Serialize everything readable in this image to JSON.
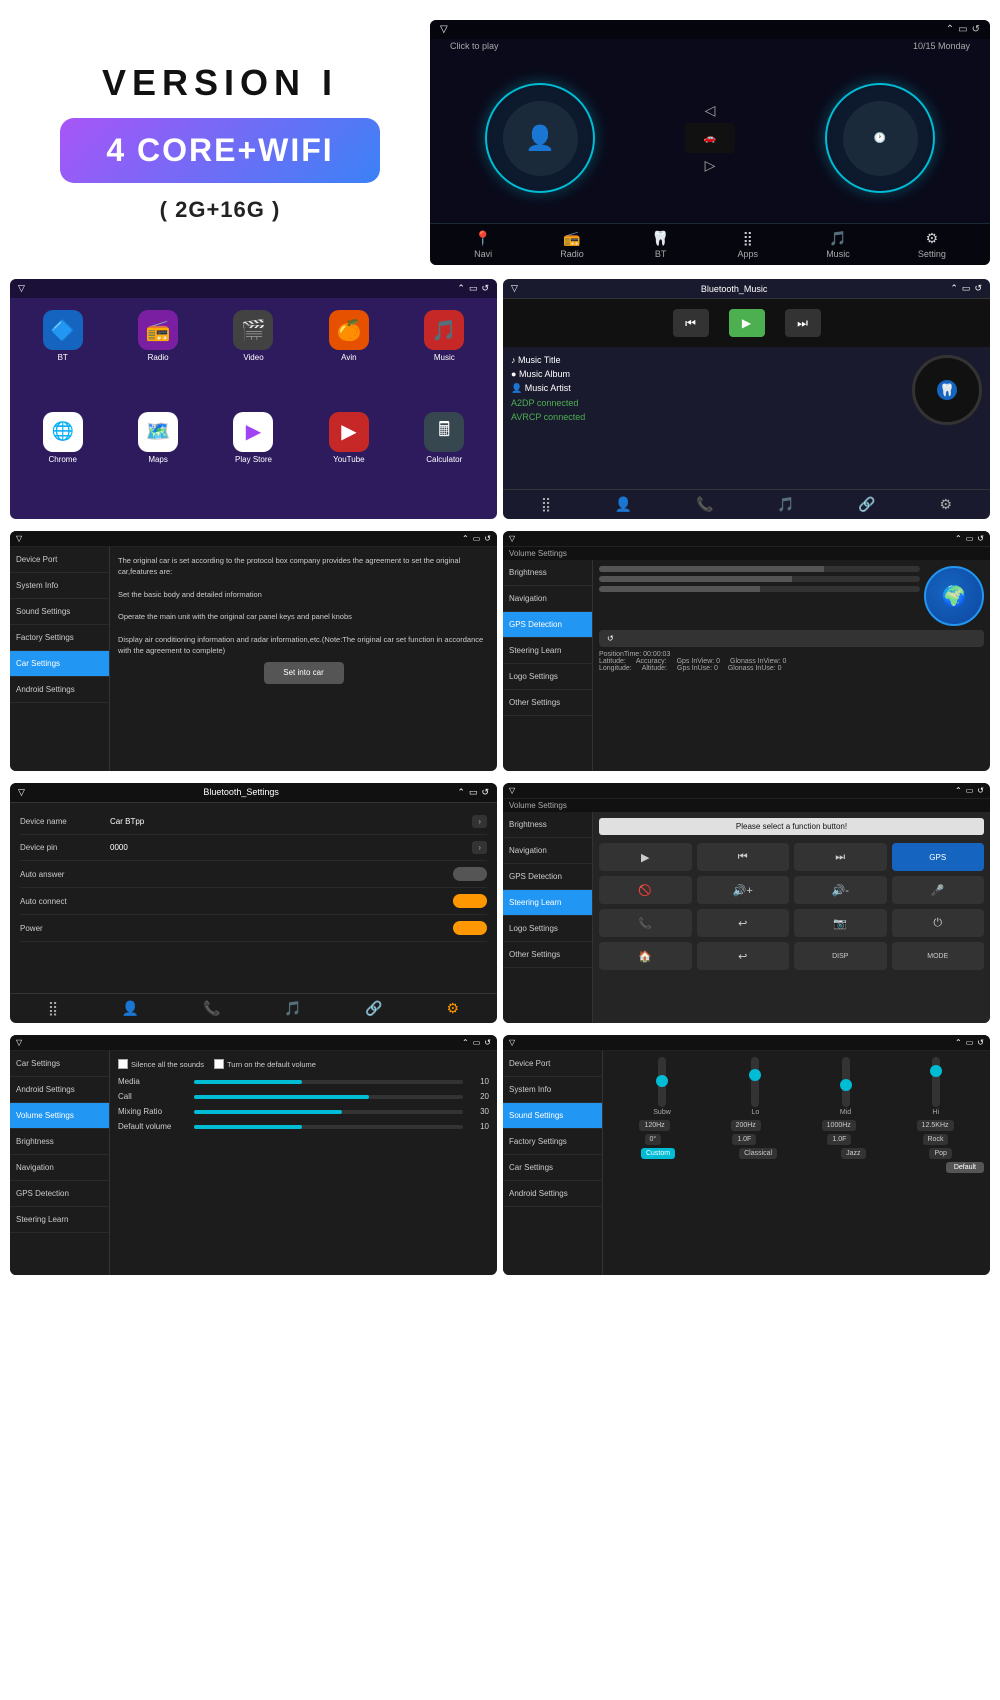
{
  "header": {
    "version_label": "VERSION  I",
    "core_wifi_label": "4 CORE+WIFI",
    "storage_label": "( 2G+16G )"
  },
  "car_screen": {
    "click_to_play": "Click to play",
    "date": "10/15 Monday",
    "nav_items": [
      "Navi",
      "Radio",
      "BT",
      "Apps",
      "Music",
      "Setting"
    ]
  },
  "app_launcher": {
    "apps": [
      {
        "label": "BT",
        "icon": "🔵"
      },
      {
        "label": "Radio",
        "icon": "📻"
      },
      {
        "label": "Video",
        "icon": "🎬"
      },
      {
        "label": "Avin",
        "icon": "🍊"
      },
      {
        "label": "Music",
        "icon": "🎵"
      },
      {
        "label": "Chrome",
        "icon": "🌐"
      },
      {
        "label": "Maps",
        "icon": "🗺️"
      },
      {
        "label": "Play Store",
        "icon": "▶"
      },
      {
        "label": "YouTube",
        "icon": "▶"
      },
      {
        "label": "Calculator",
        "icon": "🖩"
      }
    ]
  },
  "bt_music": {
    "title": "Bluetooth_Music",
    "music_title": "Music Title",
    "music_album": "Music Album",
    "music_artist": "Music Artist",
    "a2dp": "A2DP connected",
    "avrcp": "AVRCP connected"
  },
  "settings_panel": {
    "items": [
      "Device Port",
      "System Info",
      "Sound Settings",
      "Factory Settings",
      "Car Settings",
      "Android Settings"
    ],
    "active_index": 4,
    "content": "The original car is set according to the protocol box company provides the agreement to set the original car,features are:\n\nSet the basic body and detailed information\n\nOperate the main unit with the original car panel keys and panel knobs\n\nDisplay air conditioning information and radar information,etc.(Note:The original car set function in accordance with the agreement to complete)",
    "set_into_car": "Set into car"
  },
  "gps_screen": {
    "title": "Volume Settings",
    "sidebar_items": [
      "Brightness",
      "Navigation",
      "GPS Detection",
      "Steering Learn",
      "Logo Settings",
      "Other Settings"
    ],
    "active": "GPS Detection",
    "position_time": "PositionTime: 00:00:03",
    "latitude": "Latitude:",
    "longitude": "Longitude:",
    "accuracy": "Accuracy:",
    "altitude": "Altitude:",
    "gps_inview": "Gps InView: 0",
    "glonass_inview": "Glonass InView: 0",
    "gps_inuse": "Gps InUse: 0",
    "glonass_inuse": "Glonass InUse: 0"
  },
  "bt_settings": {
    "title": "Bluetooth_Settings",
    "device_name_label": "Device name",
    "device_name_value": "Car BTpp",
    "device_pin_label": "Device pin",
    "device_pin_value": "0000",
    "auto_answer_label": "Auto answer",
    "auto_connect_label": "Auto connect",
    "power_label": "Power"
  },
  "steering_screen": {
    "title": "Volume Settings",
    "sidebar_items": [
      "Brightness",
      "Navigation",
      "GPS Detection",
      "Steering Learn",
      "Logo Settings",
      "Other Settings"
    ],
    "active": "Steering Learn",
    "prompt": "Please select a function button!",
    "buttons": [
      "▶",
      "⏮",
      "⏭",
      "GPS",
      "🚫",
      "🔊+",
      "🔊-",
      "🎤",
      "📞",
      "↩",
      "📷",
      "⏻",
      "🏠",
      "↩",
      "DISP",
      "MODE"
    ]
  },
  "volume_settings": {
    "title": "Volume Settings",
    "sidebar_items": [
      "Car Settings",
      "Android Settings",
      "Volume Settings",
      "Brightness",
      "Navigation",
      "GPS Detection",
      "Steering Learn"
    ],
    "active": "Volume Settings",
    "silence_all": "Silence all the sounds",
    "turn_on_default": "Turn on the default volume",
    "media_label": "Media",
    "media_value": "10",
    "call_label": "Call",
    "call_value": "20",
    "mixing_label": "Mixing Ratio",
    "mixing_value": "30",
    "default_label": "Default volume",
    "default_value": "10"
  },
  "eq_settings": {
    "title": "Sound Settings",
    "sidebar_items": [
      "Device Port",
      "System Info",
      "Sound Settings",
      "Factory Settings",
      "Car Settings",
      "Android Settings"
    ],
    "active": "Sound Settings",
    "bar_labels": [
      "Subw",
      "Lo",
      "Mid",
      "Hi"
    ],
    "freq_buttons": [
      "120Hz",
      "200Hz",
      "1000Hz",
      "12.5KHz"
    ],
    "phase_buttons": [
      "0°",
      "1.0F",
      "1.0F",
      "Rock"
    ],
    "preset_buttons": [
      "Custom",
      "Classical",
      "Jazz",
      "Pop"
    ],
    "default_btn": "Default"
  }
}
